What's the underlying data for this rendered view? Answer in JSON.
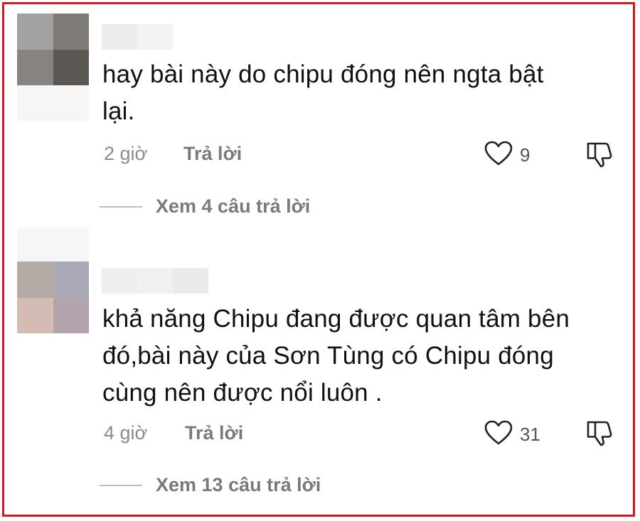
{
  "comments": [
    {
      "text_line1": "hay bài này do chipu đóng nên ngta bật",
      "text_line2": "lại.",
      "text_line3": "",
      "time": "2 giờ",
      "reply_label": "Trả lời",
      "likes": "9",
      "view_replies": "Xem 4 câu trả lời",
      "avatar_colors": [
        "#a2a2a2",
        "#7d7a77",
        "#878380",
        "#5d5753"
      ]
    },
    {
      "text_line1": "khả năng Chipu đang được quan tâm bên",
      "text_line2": "đó,bài này của Sơn Tùng có Chipu đóng",
      "text_line3": "cùng nên được nổi luôn .",
      "time": "4 giờ",
      "reply_label": "Trả lời",
      "likes": "31",
      "view_replies": "Xem 13 câu trả lời",
      "avatar_colors": [
        "#b3aaa5",
        "#a9aab5",
        "#d4bcb4",
        "#b2a3ad"
      ]
    }
  ],
  "icons": {
    "like": "heart-outline-icon",
    "dislike": "thumbs-down-outline-icon"
  },
  "colors": {
    "frame_border": "#e1141c",
    "meta_text": "#8b8b8b"
  }
}
